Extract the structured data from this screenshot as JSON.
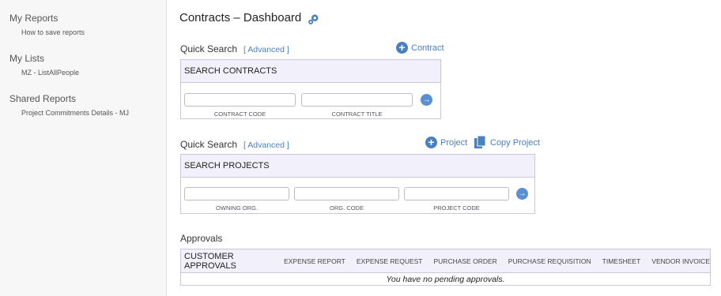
{
  "sidebar": {
    "groups": [
      {
        "heading": "My Reports",
        "link": "How to save reports"
      },
      {
        "heading": "My Lists",
        "link": "MZ - ListAllPeople"
      },
      {
        "heading": "Shared Reports",
        "link": "Project Commitments Details - MJ"
      }
    ]
  },
  "page": {
    "title": "Contracts – Dashboard"
  },
  "contracts_search": {
    "quick_search": "Quick Search",
    "advanced": "[ Advanced ]",
    "add_contract": "Contract",
    "panel_title": "SEARCH CONTRACTS",
    "fields": [
      {
        "label": "CONTRACT CODE",
        "value": ""
      },
      {
        "label": "CONTRACT TITLE",
        "value": ""
      }
    ]
  },
  "projects_search": {
    "quick_search": "Quick Search",
    "advanced": "[ Advanced ]",
    "add_project": "Project",
    "copy_project": "Copy Project",
    "panel_title": "SEARCH PROJECTS",
    "fields": [
      {
        "label": "OWNING ORG.",
        "value": ""
      },
      {
        "label": "ORG. CODE",
        "value": ""
      },
      {
        "label": "PROJECT CODE",
        "value": ""
      }
    ]
  },
  "approvals": {
    "title": "Approvals",
    "main_tab": "CUSTOMER APPROVALS",
    "tabs": [
      "EXPENSE REPORT",
      "EXPENSE REQUEST",
      "PURCHASE ORDER",
      "PURCHASE REQUISITION",
      "TIMESHEET",
      "VENDOR INVOICE"
    ],
    "empty_message": "You have no pending approvals."
  },
  "colors": {
    "accent": "#4a7fc1",
    "panel_header": "#f2f0fb",
    "sidebar_bg": "#f7f7f7"
  }
}
